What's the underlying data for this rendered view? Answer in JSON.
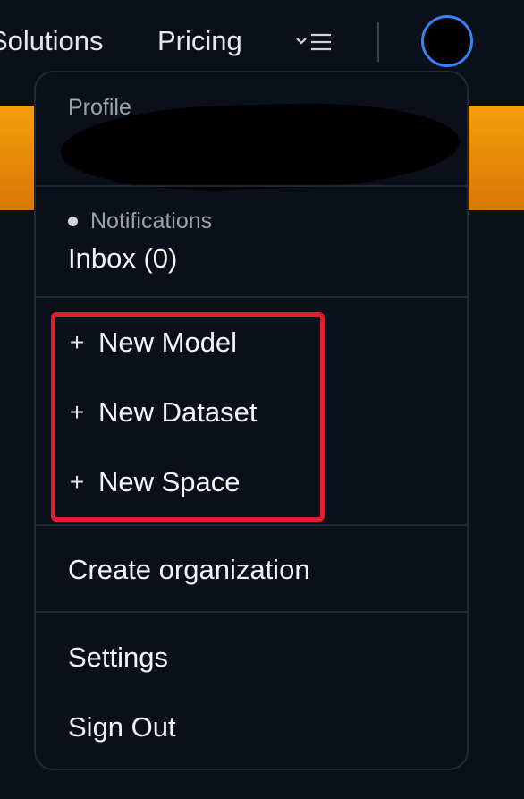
{
  "nav": {
    "solutions": "Solutions",
    "pricing": "Pricing",
    "more_icon": "chevron-down-menu-icon"
  },
  "dropdown": {
    "profile_label": "Profile",
    "notifications_label": "Notifications",
    "inbox_label": "Inbox (0)",
    "new_items": [
      {
        "label": "New Model",
        "icon": "plus-icon"
      },
      {
        "label": "New Dataset",
        "icon": "plus-icon"
      },
      {
        "label": "New Space",
        "icon": "plus-icon"
      }
    ],
    "create_org": "Create organization",
    "settings": "Settings",
    "sign_out": "Sign Out"
  },
  "colors": {
    "background": "#0b0f19",
    "avatar_ring": "#3b82f6",
    "banner": "#f59e0b",
    "highlight": "#e11d2e"
  }
}
